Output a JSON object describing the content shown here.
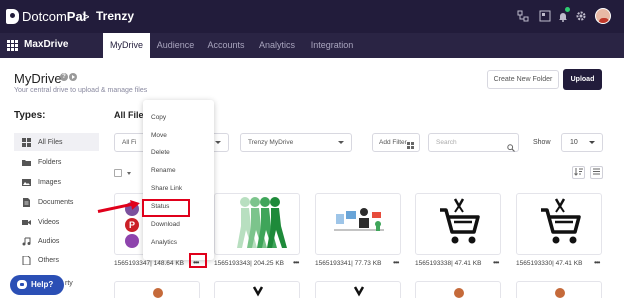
{
  "topbar": {
    "brand_light": "Dotcom",
    "brand_bold": "Pal",
    "separator": ">",
    "workspace": "Trenzy",
    "icons": [
      "org-chart-icon",
      "dashboard-icon",
      "bell-icon",
      "gear-icon",
      "avatar"
    ]
  },
  "nav": {
    "app_name": "MaxDrive",
    "tabs": [
      {
        "label": "MyDrive",
        "active": true
      },
      {
        "label": "Audience",
        "active": false
      },
      {
        "label": "Accounts",
        "active": false
      },
      {
        "label": "Analytics",
        "active": false
      },
      {
        "label": "Integration",
        "active": false
      }
    ]
  },
  "header": {
    "title": "MyDrive",
    "subtitle": "Your central drive to upload & manage files",
    "new_folder_label": "Create New Folder",
    "upload_label": "Upload"
  },
  "sidebar": {
    "title": "Types:",
    "items": [
      {
        "label": "All Files",
        "icon": "grid-icon",
        "active": true
      },
      {
        "label": "Folders",
        "icon": "folder-icon",
        "active": false
      },
      {
        "label": "Images",
        "icon": "image-icon",
        "active": false
      },
      {
        "label": "Documents",
        "icon": "document-icon",
        "active": false
      },
      {
        "label": "Videos",
        "icon": "video-icon",
        "active": false
      },
      {
        "label": "Audios",
        "icon": "music-icon",
        "active": false
      },
      {
        "label": "Others",
        "icon": "file-icon",
        "active": false
      }
    ],
    "overflow_text": "rty"
  },
  "content": {
    "section_title": "All Files",
    "filter_type": "All Fi",
    "folder_filter": "Trenzy MyDrive",
    "add_filter_label": "Add Filter",
    "search_placeholder": "Search",
    "show_label": "Show",
    "show_count": "10"
  },
  "context_menu": {
    "items": [
      "Copy",
      "Move",
      "Delete",
      "Rename",
      "Share Link",
      "Status",
      "Download",
      "Analytics"
    ],
    "highlighted": "Status"
  },
  "cards": [
    {
      "name": "1565193347",
      "size": "148.64 KB",
      "thumbnail": "social-logos"
    },
    {
      "name": "1565193343",
      "size": "204.25 KB",
      "thumbnail": "walking-figures"
    },
    {
      "name": "1565193341",
      "size": "77.73 KB",
      "thumbnail": "office-scene"
    },
    {
      "name": "1565193338",
      "size": "47.41 KB",
      "thumbnail": "cart-icon"
    },
    {
      "name": "1565193330",
      "size": "47.41 KB",
      "thumbnail": "cart-icon"
    }
  ],
  "more_label": "•••",
  "help": {
    "label": "Help?"
  },
  "colors": {
    "header_bg": "#221c3b",
    "nav_bg": "#2a2444",
    "accent_red": "#e0001b",
    "help_blue": "#2b4fb5",
    "figure_green": "#1e8a3a"
  }
}
